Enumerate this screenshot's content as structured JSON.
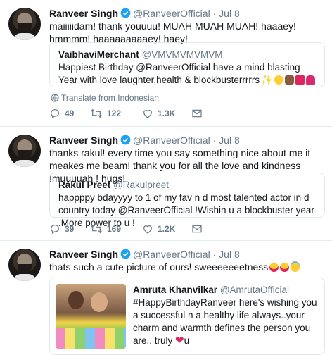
{
  "tweets": [
    {
      "name": "Ranveer Singh",
      "handle": "@RanveerOfficial",
      "dot": "·",
      "date": "Jul 8",
      "text": "maiiiiidam! thank youuuu! MUAH MUAH MUAH! haaaey! hmmmm! haaaaaaaaaey! haey!",
      "quote": {
        "name": "VaibhaviMerchant",
        "handle": "@VMVMVMVMVM",
        "text": "Happiest Birthday @RanveerOfficial  have a mind blasting Year with love laughter,health & blockbusterrrrrs"
      },
      "translate": "Translate from Indonesian",
      "replies": "49",
      "retweets": "122",
      "likes": "1.3K"
    },
    {
      "name": "Ranveer Singh",
      "handle": "@RanveerOfficial",
      "dot": "·",
      "date": "Jul 8",
      "text": "thanks rakul! every time you say something nice about me it meakes me beam! thank you for all the love and kindness !muuuuah ! hugs!",
      "quote": {
        "name": "Rakul Preet",
        "handle": "@Rakulpreet",
        "text": "happppy bdayyyy to 1 of my fav n d most talented actor in d country today @RanveerOfficial !Wishin u a blockbuster year .More power to u !"
      },
      "replies": "39",
      "retweets": "169",
      "likes": "1.2K"
    },
    {
      "name": "Ranveer Singh",
      "handle": "@RanveerOfficial",
      "dot": "·",
      "date": "Jul 8",
      "text": "thats such a cute picture of ours! sweeeeeeetness",
      "quote": {
        "name": "Amruta Khanvilkar",
        "handle": "@AmrutaOfficial",
        "text": "#HappyBirthdayRanveer here's wishing you a successful n a healthy life always..your charm and warmth defines the person you are.. truly",
        "text_tail": "u"
      }
    }
  ],
  "colors": {
    "verified": "#1da1f2",
    "muted": "#657786",
    "border": "#e1e8ed",
    "heart": "#e0245e"
  }
}
